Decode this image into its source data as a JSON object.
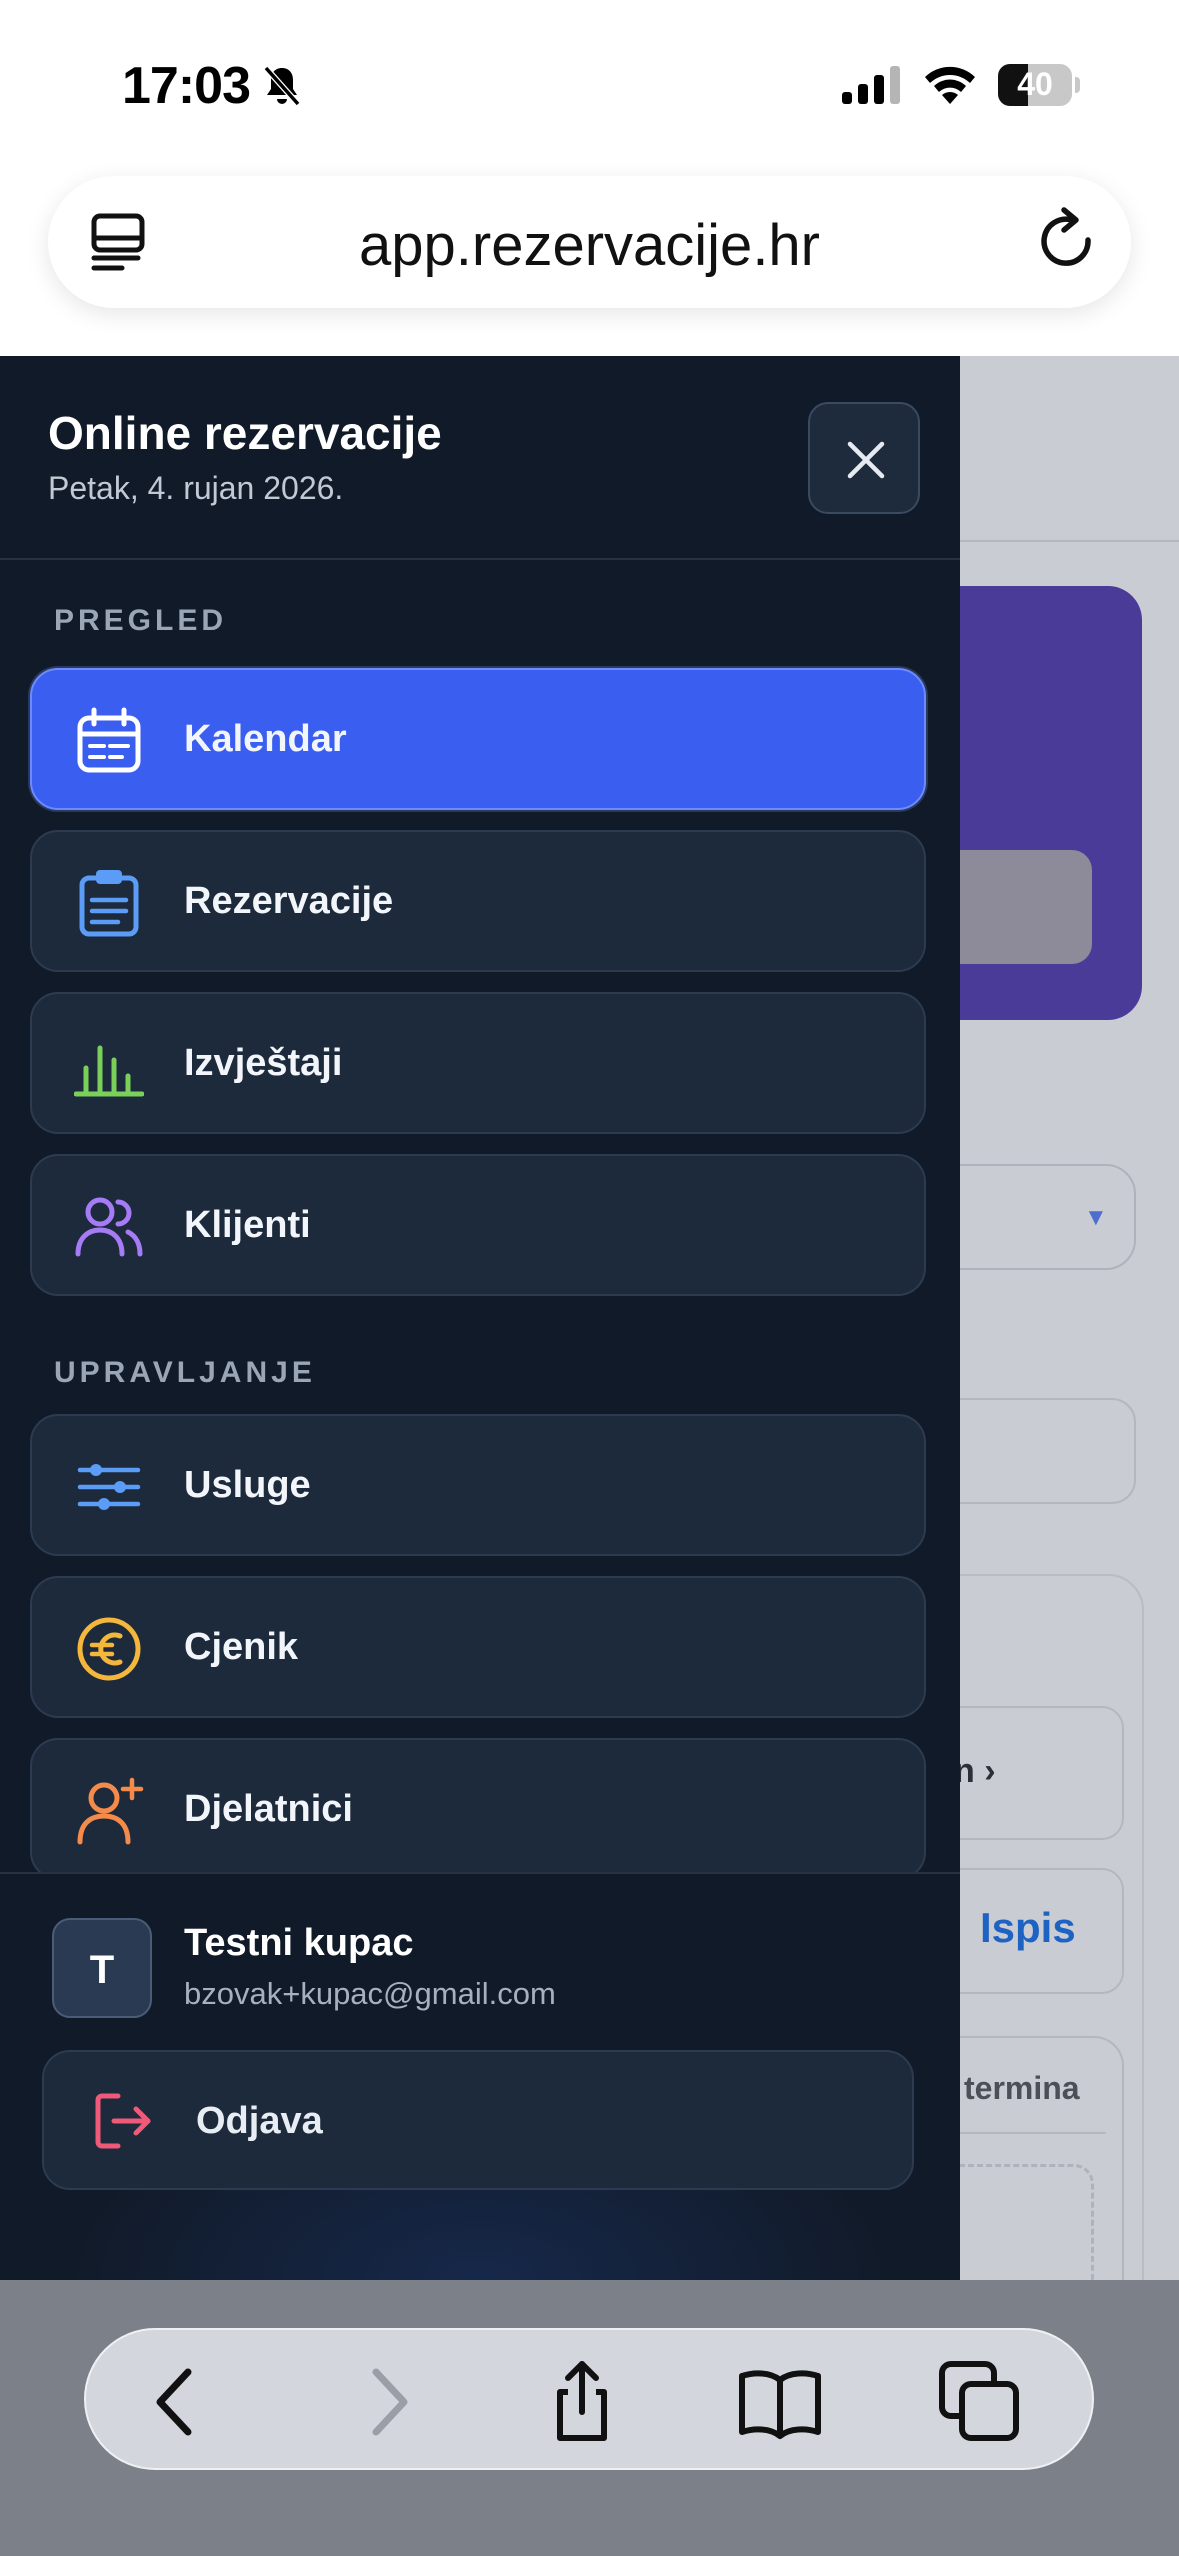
{
  "status_bar": {
    "time": "17:03",
    "battery_level": "40",
    "battery_fraction": 0.4,
    "icons": [
      "bell-slash-icon",
      "cellular-signal-icon",
      "wifi-icon",
      "battery-icon"
    ]
  },
  "browser": {
    "url": "app.rezervacije.hr",
    "icons": [
      "reader-mode-icon",
      "reload-icon"
    ]
  },
  "background_page": {
    "button_partial": "n ›",
    "print_label": "Ispis",
    "slots_label": "termina"
  },
  "drawer": {
    "title": "Online rezervacije",
    "date": "Petak, 4. rujan 2026.",
    "sections": [
      {
        "label": "PREGLED",
        "items": [
          {
            "label": "Kalendar",
            "icon": "calendar-icon",
            "active": true,
            "color": "#ffffff"
          },
          {
            "label": "Rezervacije",
            "icon": "clipboard-icon",
            "active": false,
            "color": "#5b9cf6"
          },
          {
            "label": "Izvještaji",
            "icon": "bar-chart-icon",
            "active": false,
            "color": "#7bd05a"
          },
          {
            "label": "Klijenti",
            "icon": "users-icon",
            "active": false,
            "color": "#a57cf5"
          }
        ]
      },
      {
        "label": "UPRAVLJANJE",
        "items": [
          {
            "label": "Usluge",
            "icon": "sliders-icon",
            "active": false,
            "color": "#5b9cf6"
          },
          {
            "label": "Cjenik",
            "icon": "euro-icon",
            "active": false,
            "color": "#f5b73b"
          },
          {
            "label": "Djelatnici",
            "icon": "add-user-icon",
            "active": false,
            "color": "#f58b4a"
          }
        ]
      }
    ],
    "user": {
      "initial": "T",
      "name": "Testni kupac",
      "email": "bzovak+kupac@gmail.com"
    },
    "logout_label": "Odjava",
    "accent_color": "#3a5ef0"
  },
  "safari_toolbar": {
    "icons": [
      "back-icon",
      "forward-icon",
      "share-icon",
      "bookmarks-icon",
      "tabs-icon"
    ]
  }
}
